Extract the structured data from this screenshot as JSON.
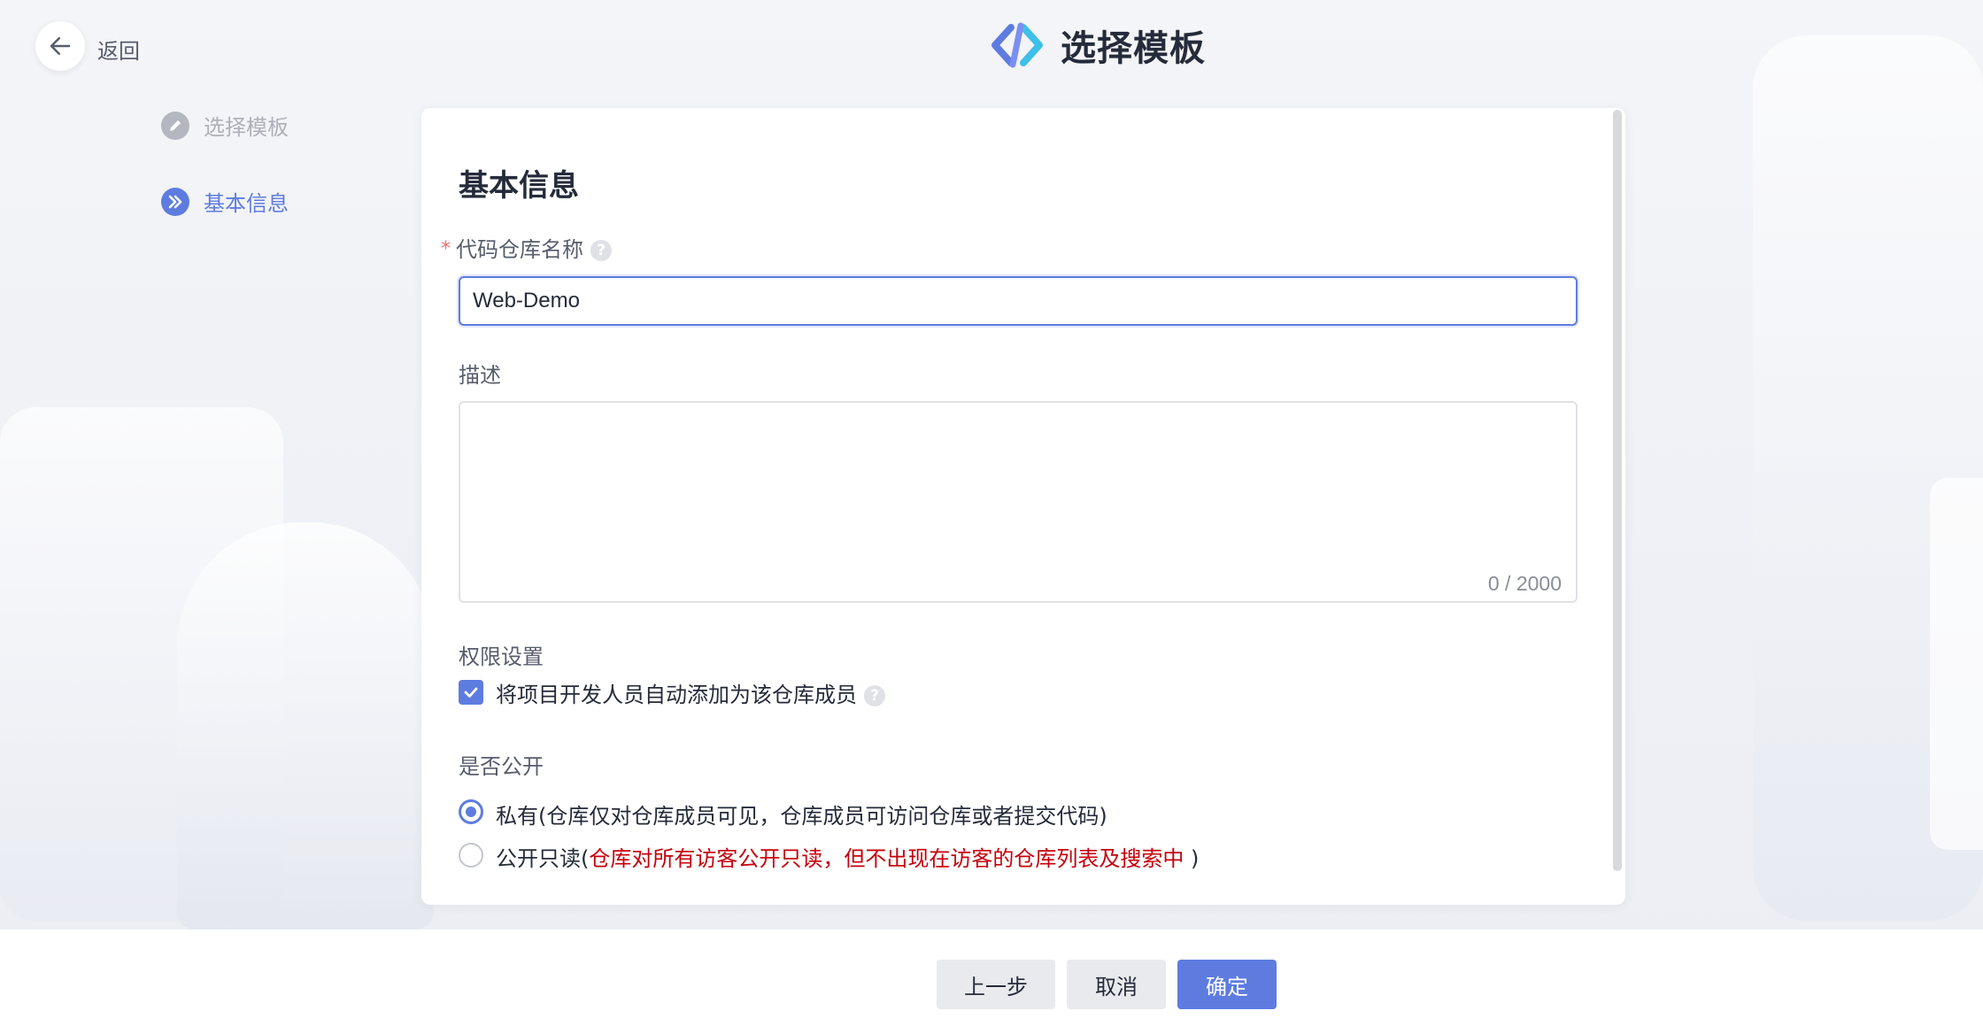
{
  "header": {
    "back_label": "返回",
    "title": "选择模板"
  },
  "steps": [
    {
      "label": "选择模板",
      "state": "done"
    },
    {
      "label": "基本信息",
      "state": "active"
    }
  ],
  "form": {
    "section_title": "基本信息",
    "repo_name": {
      "label": "代码仓库名称",
      "required_mark": "*",
      "value": "Web-Demo"
    },
    "description": {
      "label": "描述",
      "value": "",
      "counter": "0 / 2000"
    },
    "permissions": {
      "label": "权限设置",
      "auto_add_members": {
        "label": "将项目开发人员自动添加为该仓库成员",
        "checked": true
      }
    },
    "visibility": {
      "label": "是否公开",
      "options": [
        {
          "label": "私有(仓库仅对仓库成员可见，仓库成员可访问仓库或者提交代码)",
          "selected": true
        },
        {
          "label_prefix": "公开只读(",
          "label_warning": "仓库对所有访客公开只读，但不出现在访客的仓库列表及搜索中 ",
          "label_suffix": ")",
          "selected": false
        }
      ]
    }
  },
  "footer": {
    "prev_label": "上一步",
    "cancel_label": "取消",
    "confirm_label": "确定"
  },
  "colors": {
    "accent": "#5e7ce0",
    "warning_text": "#c7000b",
    "required": "#f66f6a"
  }
}
